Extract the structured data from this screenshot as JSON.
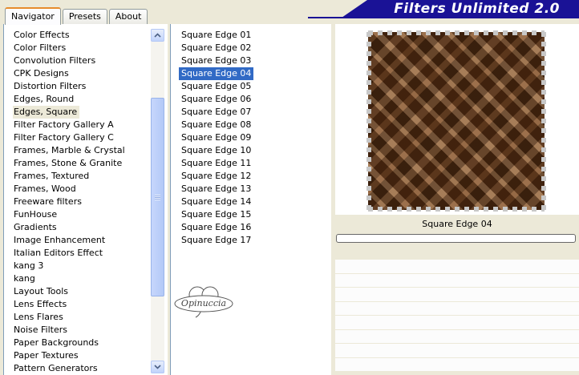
{
  "tabs": [
    {
      "label": "Navigator",
      "active": true
    },
    {
      "label": "Presets",
      "active": false
    },
    {
      "label": "About",
      "active": false
    }
  ],
  "banner": {
    "title": "Filters Unlimited 2.0",
    "color": "#1a1296"
  },
  "categories": {
    "selected": "Edges, Square",
    "items": [
      "Color Effects",
      "Color Filters",
      "Convolution Filters",
      "CPK Designs",
      "Distortion Filters",
      "Edges, Round",
      "Edges, Square",
      "Filter Factory Gallery A",
      "Filter Factory Gallery C",
      "Frames, Marble & Crystal",
      "Frames, Stone & Granite",
      "Frames, Textured",
      "Frames, Wood",
      "Freeware filters",
      "FunHouse",
      "Gradients",
      "Image Enhancement",
      "Italian Editors Effect",
      "kang 3",
      "kang",
      "Layout Tools",
      "Lens Effects",
      "Lens Flares",
      "Noise Filters",
      "Paper Backgrounds",
      "Paper Textures",
      "Pattern Generators"
    ]
  },
  "filters": {
    "selected": "Square Edge 04",
    "items": [
      "Square Edge 01",
      "Square Edge 02",
      "Square Edge 03",
      "Square Edge 04",
      "Square Edge 05",
      "Square Edge 06",
      "Square Edge 07",
      "Square Edge 08",
      "Square Edge 09",
      "Square Edge 10",
      "Square Edge 11",
      "Square Edge 12",
      "Square Edge 13",
      "Square Edge 14",
      "Square Edge 15",
      "Square Edge 16",
      "Square Edge 17"
    ]
  },
  "preview": {
    "caption": "Square Edge 04"
  },
  "progress": {
    "value": 0
  },
  "watermark": {
    "text": "Opinuccia"
  },
  "icons": {
    "scroll_up": "chevron-up-icon",
    "scroll_down": "chevron-down-icon"
  },
  "colors": {
    "selection": "#316ac5",
    "tab_accent": "#e68b2c",
    "background": "#ece9d8"
  }
}
